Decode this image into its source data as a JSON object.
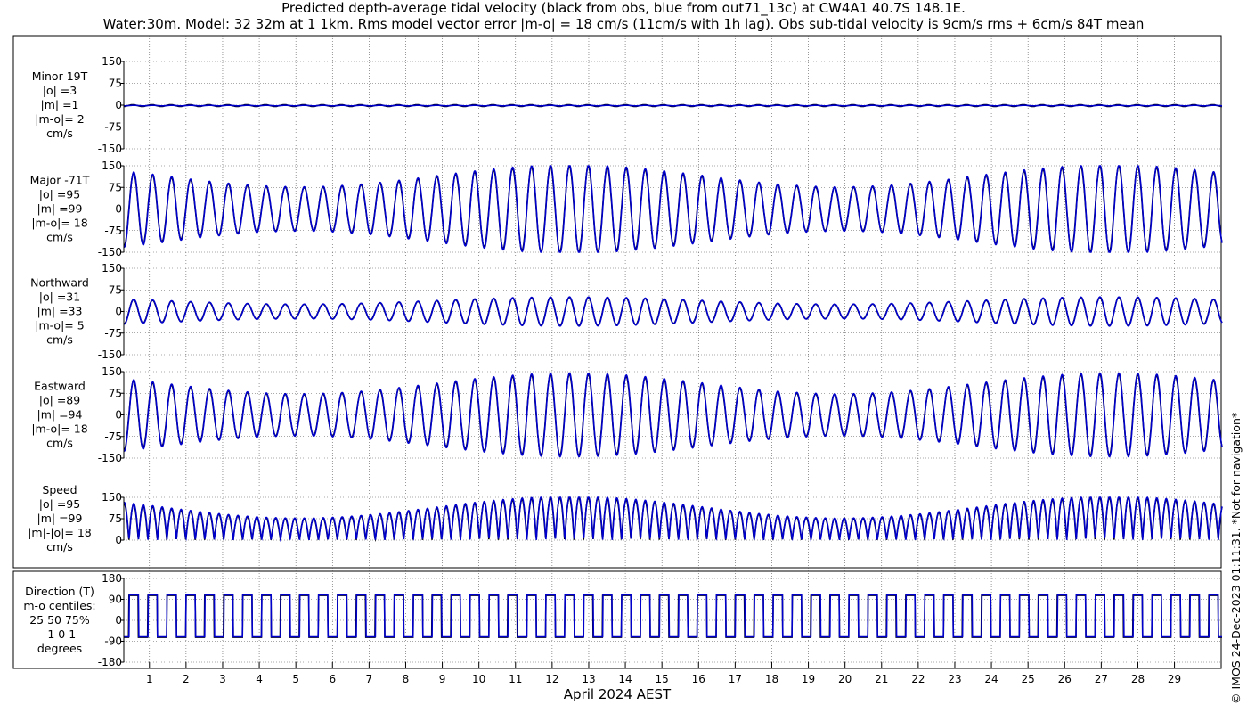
{
  "title_line1": "Predicted depth-average tidal velocity (black from obs, blue from out71_13c) at CW4A1 40.7S 148.1E.",
  "title_line2": "Water:30m. Model: 32 32m at 1 1km. Rms model vector error |m-o| = 18 cm/s (11cm/s with 1h lag). Obs sub-tidal velocity is 9cm/s rms + 6cm/s 84T mean",
  "side_note": "© IMOS 24-Dec-2023 01:11:31. *Not for navigation*",
  "colors": {
    "obs": "#000000",
    "model": "#0000cc",
    "grid": "#555555"
  },
  "chart_data": {
    "type": "line",
    "xlabel": "April 2024 AEST",
    "x_ticks": [
      "1",
      "2",
      "3",
      "4",
      "5",
      "6",
      "7",
      "8",
      "9",
      "10",
      "11",
      "12",
      "13",
      "14",
      "15",
      "16",
      "17",
      "18",
      "19",
      "20",
      "21",
      "22",
      "23",
      "24",
      "25",
      "26",
      "27",
      "28",
      "29"
    ],
    "xlim_days": [
      0.3,
      30.3
    ],
    "series_names": [
      "obs",
      "model"
    ],
    "panels": [
      {
        "id": "minor",
        "labels": [
          "Minor 19T",
          "|o| =3",
          "|m| =1",
          "|m-o|= 2",
          "cm/s"
        ],
        "ylim": [
          -150,
          150
        ],
        "yticks": [
          "150",
          "75",
          "0",
          "-75",
          "-150"
        ],
        "ytick_values": [
          150,
          75,
          0,
          -75,
          -150
        ],
        "kind": "minor",
        "amp_obs": 3,
        "amp_model": 1
      },
      {
        "id": "major",
        "labels": [
          "Major -71T",
          "|o| =95",
          "|m| =99",
          "|m-o|= 18",
          "cm/s"
        ],
        "ylim": [
          -150,
          150
        ],
        "yticks": [
          "150",
          "75",
          "0",
          "-75",
          "-150"
        ],
        "ytick_values": [
          150,
          75,
          0,
          -75,
          -150
        ],
        "kind": "tidal",
        "amp_scale": 1.0
      },
      {
        "id": "north",
        "labels": [
          "Northward",
          "|o| =31",
          "|m| =33",
          "|m-o|= 5",
          "cm/s"
        ],
        "ylim": [
          -150,
          150
        ],
        "yticks": [
          "150",
          "75",
          "0",
          "-75",
          "-150"
        ],
        "ytick_values": [
          150,
          75,
          0,
          -75,
          -150
        ],
        "kind": "tidal",
        "amp_scale": 0.33
      },
      {
        "id": "east",
        "labels": [
          "Eastward",
          "|o| =89",
          "|m| =94",
          "|m-o|= 18",
          "cm/s"
        ],
        "ylim": [
          -150,
          150
        ],
        "yticks": [
          "150",
          "75",
          "0",
          "-75",
          "-150"
        ],
        "ytick_values": [
          150,
          75,
          0,
          -75,
          -150
        ],
        "kind": "tidal",
        "amp_scale": 0.95
      },
      {
        "id": "speed",
        "labels": [
          "Speed",
          "|o| =95",
          "|m| =99",
          "|m|-|o|= 18",
          "cm/s"
        ],
        "ylim": [
          0,
          150
        ],
        "yticks": [
          "150",
          "75",
          "0"
        ],
        "ytick_values": [
          150,
          75,
          0
        ],
        "kind": "speed",
        "amp_scale": 1.0
      },
      {
        "id": "direction",
        "labels": [
          "Direction (T)",
          "m-o centiles:",
          "25  50  75%",
          "-1  0  1",
          "degrees"
        ],
        "ylim": [
          -180,
          180
        ],
        "yticks": [
          "180",
          "90",
          "0",
          "-90",
          "-180"
        ],
        "ytick_values": [
          180,
          90,
          0,
          -90,
          -180
        ],
        "kind": "direction",
        "dir_high": 109,
        "dir_low": -71
      }
    ]
  }
}
